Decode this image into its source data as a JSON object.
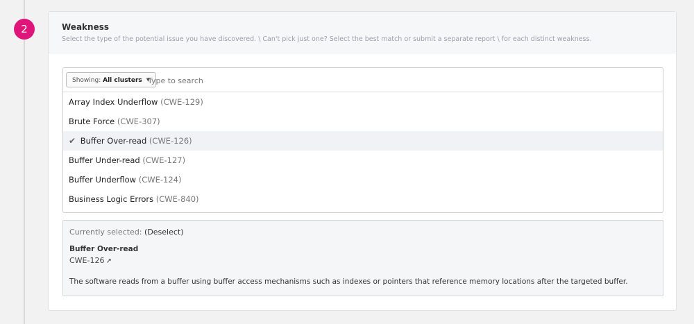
{
  "step": {
    "number": "2"
  },
  "weakness": {
    "title": "Weakness",
    "subtitle": "Select the type of the potential issue you have discovered. \\ Can't pick just one? Select the best match or submit a separate report \\ for each distinct weakness."
  },
  "picker": {
    "showing_prefix": "Showing:",
    "showing_value": "All clusters",
    "search_placeholder": "Type to search",
    "items": [
      {
        "name": "Array Index Underflow",
        "code": "(CWE-129)"
      },
      {
        "name": "Brute Force",
        "code": "(CWE-307)"
      },
      {
        "name": "Buffer Over-read",
        "code": "(CWE-126)"
      },
      {
        "name": "Buffer Under-read",
        "code": "(CWE-127)"
      },
      {
        "name": "Buffer Underflow",
        "code": "(CWE-124)"
      },
      {
        "name": "Business Logic Errors",
        "code": "(CWE-840)"
      }
    ],
    "selected_index": 2
  },
  "selection": {
    "label": "Currently selected:",
    "deselect": "(Deselect)",
    "name": "Buffer Over-read",
    "code": "CWE-126",
    "description": "The software reads from a buffer using buffer access mechanisms such as indexes or pointers that reference memory locations after the targeted buffer."
  },
  "colors": {
    "badge": "#e0157a"
  },
  "icons": {
    "check": "checkmark-icon",
    "external": "external-link-icon",
    "caret": "caret-down-icon"
  }
}
